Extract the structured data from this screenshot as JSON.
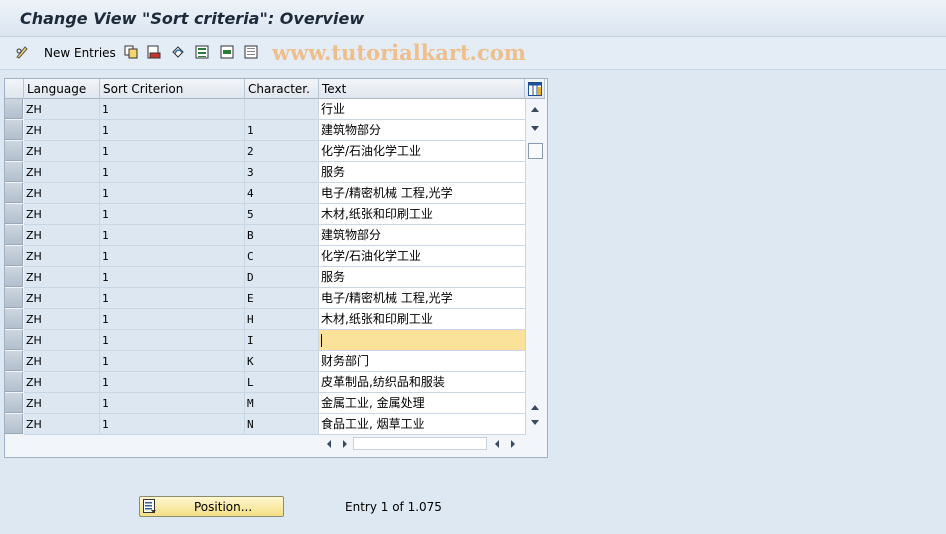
{
  "window": {
    "title": "Change View \"Sort criteria\": Overview"
  },
  "toolbar": {
    "new_entries_label": "New Entries",
    "watermark": "www.tutorialkart.com",
    "icons": [
      "edit-glasses-icon",
      "copy-icon",
      "delete-icon",
      "undo-icon",
      "select-all-icon",
      "select-block-icon",
      "deselect-all-icon"
    ]
  },
  "table": {
    "columns": [
      "Language",
      "Sort Criterion",
      "Character.",
      "Text"
    ],
    "rows": [
      {
        "language": "ZH",
        "sort": "1",
        "char": "",
        "text": "行业"
      },
      {
        "language": "ZH",
        "sort": "1",
        "char": "1",
        "text": "建筑物部分"
      },
      {
        "language": "ZH",
        "sort": "1",
        "char": "2",
        "text": "化学/石油化学工业"
      },
      {
        "language": "ZH",
        "sort": "1",
        "char": "3",
        "text": "服务"
      },
      {
        "language": "ZH",
        "sort": "1",
        "char": "4",
        "text": "电子/精密机械 工程,光学"
      },
      {
        "language": "ZH",
        "sort": "1",
        "char": "5",
        "text": "木材,纸张和印刷工业"
      },
      {
        "language": "ZH",
        "sort": "1",
        "char": "B",
        "text": "建筑物部分"
      },
      {
        "language": "ZH",
        "sort": "1",
        "char": "C",
        "text": "化学/石油化学工业"
      },
      {
        "language": "ZH",
        "sort": "1",
        "char": "D",
        "text": "服务"
      },
      {
        "language": "ZH",
        "sort": "1",
        "char": "E",
        "text": "电子/精密机械 工程,光学"
      },
      {
        "language": "ZH",
        "sort": "1",
        "char": "H",
        "text": "木材,纸张和印刷工业"
      },
      {
        "language": "ZH",
        "sort": "1",
        "char": "I",
        "text": ""
      },
      {
        "language": "ZH",
        "sort": "1",
        "char": "K",
        "text": "财务部门"
      },
      {
        "language": "ZH",
        "sort": "1",
        "char": "L",
        "text": "皮革制品,纺织品和服装"
      },
      {
        "language": "ZH",
        "sort": "1",
        "char": "M",
        "text": "金属工业, 金属处理"
      },
      {
        "language": "ZH",
        "sort": "1",
        "char": "N",
        "text": "食品工业, 烟草工业"
      }
    ],
    "active_row": 11
  },
  "footer": {
    "position_button_label": "Position...",
    "entry_info": "Entry 1 of 1.075"
  },
  "colors": {
    "active_cell": "#fbe29a",
    "title_text": "#1d2a3a",
    "button_face": "#f4df84"
  }
}
